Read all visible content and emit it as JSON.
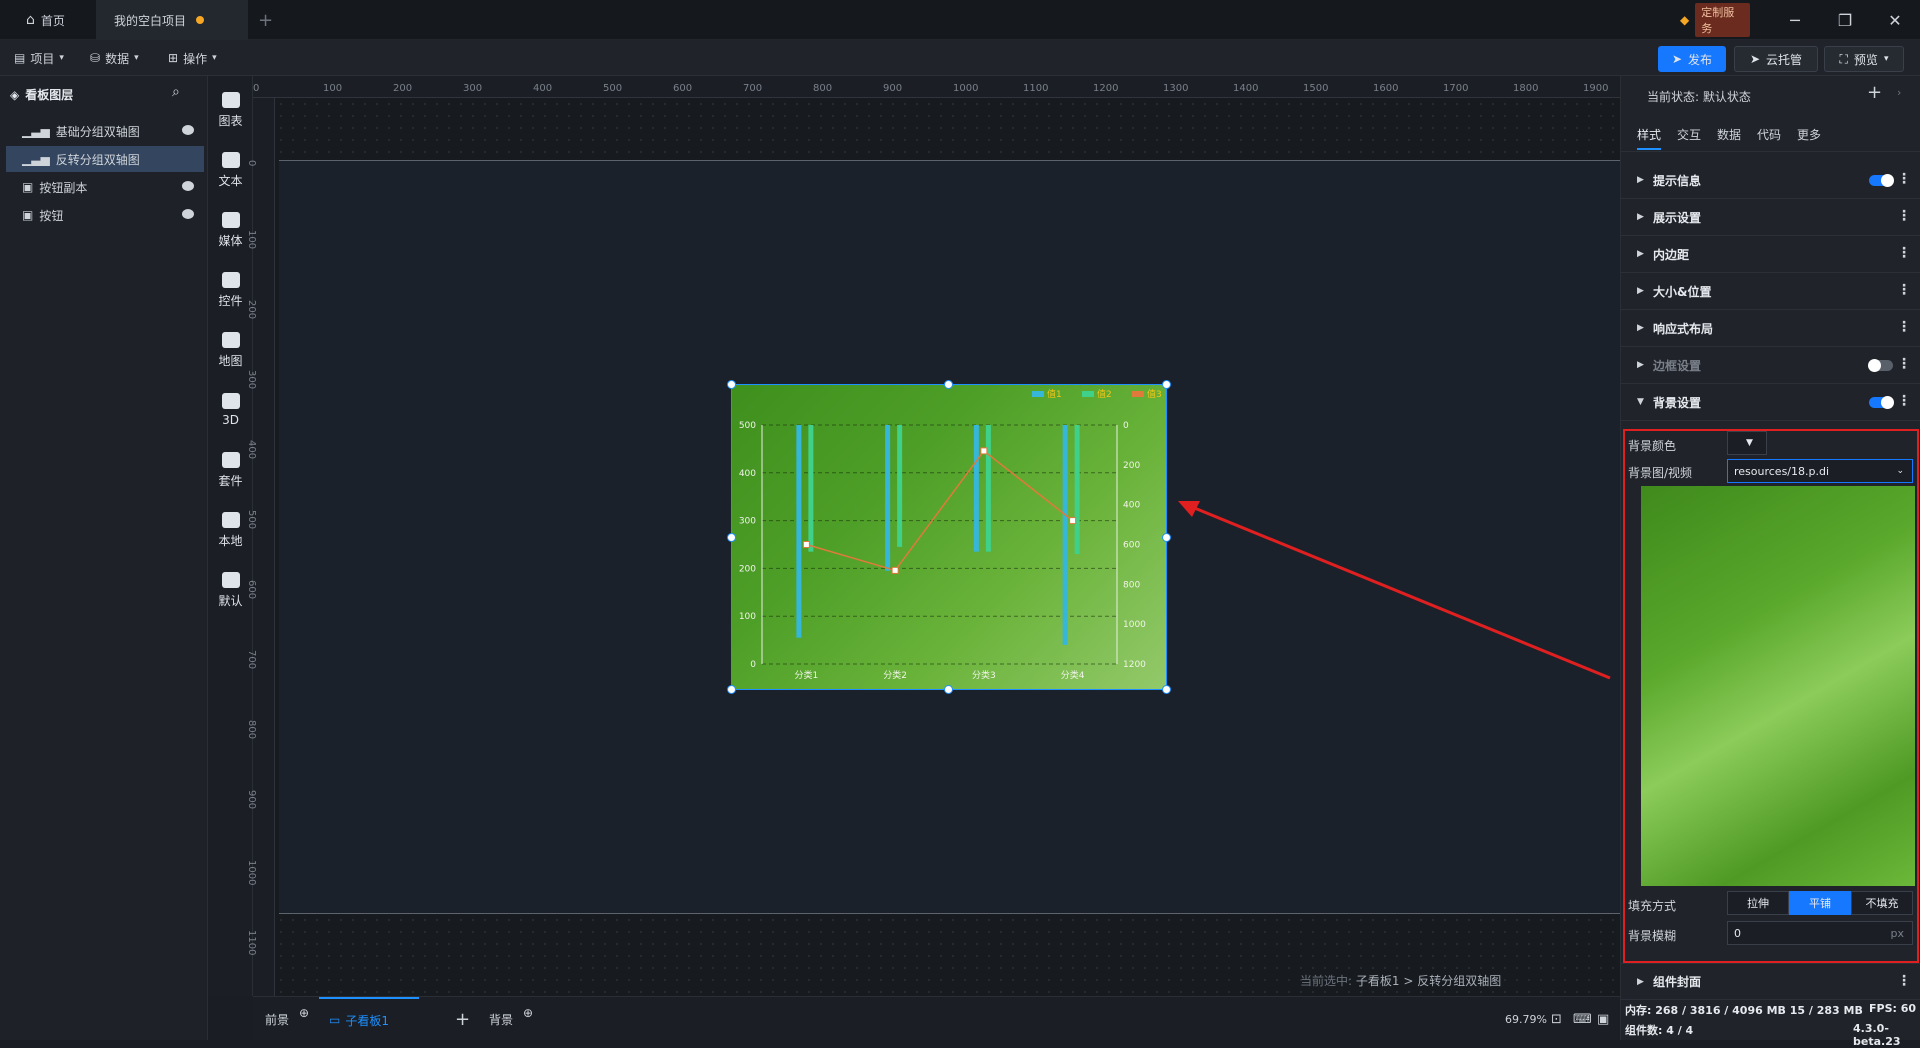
{
  "titlebar": {
    "home_tab": "首页",
    "project_tab": "我的空白项目",
    "custom_service": "定制服务"
  },
  "menubar": {
    "project": "项目",
    "data": "数据",
    "operate": "操作",
    "publish": "发布",
    "cloud_host": "云托管",
    "preview": "预览"
  },
  "layers": {
    "title": "看板图层",
    "items": [
      {
        "label": "基础分组双轴图",
        "selected": false
      },
      {
        "label": "反转分组双轴图",
        "selected": true
      },
      {
        "label": "按钮副本",
        "selected": false
      },
      {
        "label": "按钮",
        "selected": false
      }
    ]
  },
  "widgets": [
    "图表",
    "文本",
    "媒体",
    "控件",
    "地图",
    "3D",
    "套件",
    "本地",
    "默认"
  ],
  "ruler": {
    "top": [
      "0",
      "100",
      "200",
      "300",
      "400",
      "500",
      "600",
      "700",
      "800",
      "900",
      "1000",
      "1100",
      "1200",
      "1300",
      "1400",
      "1500",
      "1600",
      "1700",
      "1800",
      "1900"
    ],
    "left": [
      "0",
      "100",
      "200",
      "300",
      "400",
      "500",
      "600",
      "700",
      "800",
      "900",
      "1000",
      "1100"
    ]
  },
  "chart_data": {
    "type": "bar",
    "categories": [
      "分类1",
      "分类2",
      "分类3",
      "分类4"
    ],
    "legend": [
      "值1",
      "值2",
      "值3"
    ],
    "left_axis": {
      "ticks": [
        "0",
        "100",
        "200",
        "300",
        "400",
        "500"
      ],
      "ylim": [
        0,
        500
      ]
    },
    "right_axis": {
      "ticks": [
        "0",
        "200",
        "400",
        "600",
        "800",
        "1000",
        "1200"
      ],
      "ylim": [
        0,
        1200
      ],
      "inverted": true
    },
    "series": [
      {
        "name": "值1",
        "type": "bar",
        "axis": "left",
        "values": [
          445,
          305,
          265,
          460
        ],
        "color": "#36b6d8"
      },
      {
        "name": "值2",
        "type": "bar",
        "axis": "left",
        "values": [
          265,
          255,
          265,
          270
        ],
        "color": "#3fd08a"
      },
      {
        "name": "值3",
        "type": "line",
        "axis": "right",
        "values": [
          600,
          730,
          130,
          480
        ],
        "color": "#e07a3a"
      }
    ],
    "grid": true
  },
  "canvas": {
    "status_prefix": "当前选中:",
    "status_path": "子看板1 > 反转分组双轴图"
  },
  "bottombar": {
    "front": "前景",
    "sub_board": "子看板1",
    "background": "背景",
    "zoom": "69.79%"
  },
  "rpanel": {
    "state_label": "当前状态:",
    "state_value": "默认状态",
    "tabs": [
      "样式",
      "交互",
      "数据",
      "代码",
      "更多"
    ],
    "sections": [
      {
        "label": "提示信息",
        "toggle": true
      },
      {
        "label": "展示设置",
        "toggle": null
      },
      {
        "label": "内边距",
        "toggle": null
      },
      {
        "label": "大小&位置",
        "toggle": null
      },
      {
        "label": "响应式布局",
        "toggle": null
      },
      {
        "label": "边框设置",
        "toggle": false
      },
      {
        "label": "背景设置",
        "toggle": true
      }
    ],
    "bg": {
      "color_label": "背景颜色",
      "image_label": "背景图/视频",
      "image_value": "resources/18.p.di",
      "fill_label": "填充方式",
      "fill_options": [
        "拉伸",
        "平铺",
        "不填充"
      ],
      "fill_selected": "平铺",
      "blur_label": "背景模糊",
      "blur_value": "0",
      "blur_unit": "px"
    },
    "cover_section": "组件封面",
    "footer": {
      "memory": "内存: 268 / 3816 / 4096 MB  15 / 283 MB",
      "fps": "FPS: 60",
      "count": "组件数: 4 / 4",
      "version": "4.3.0-beta.23"
    }
  },
  "colors": {
    "accent": "#1677ff",
    "selection": "#34465f",
    "annotation": "#e02020"
  }
}
